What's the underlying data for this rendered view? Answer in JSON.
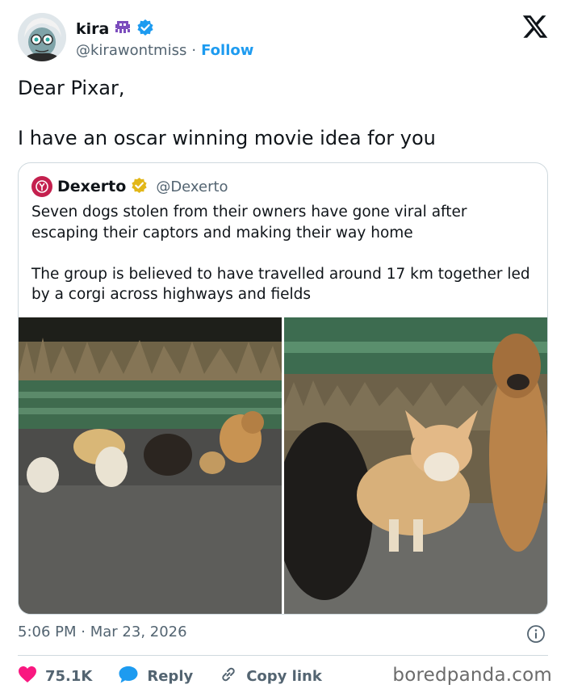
{
  "author": {
    "display_name": "kira",
    "handle": "@kirawontmiss",
    "separator": "·",
    "follow_label": "Follow"
  },
  "tweet": {
    "lines": [
      "Dear Pixar,",
      "I have an oscar winning movie idea for you"
    ]
  },
  "quoted": {
    "display_name": "Dexerto",
    "handle": "@Dexerto",
    "paragraphs": [
      "Seven dogs stolen from their owners have gone viral after escaping their captors and making their way home",
      "The group is believed to have travelled around 17 km together led by a corgi across highways and fields"
    ]
  },
  "meta": {
    "time": "5:06 PM",
    "separator": "·",
    "date": "Mar 23, 2026"
  },
  "actions": {
    "like_count": "75.1K",
    "reply_label": "Reply",
    "copy_label": "Copy link"
  },
  "watermark": "boredpanda.com",
  "colors": {
    "accent": "#1d9bf0",
    "like": "#f91880",
    "verified_gold": "#e2b719",
    "text_secondary": "#536471",
    "border": "#cfd9de"
  },
  "icons": [
    "x-logo-icon",
    "verified-badge-icon",
    "alien-emoji-icon",
    "gold-verified-badge-icon",
    "info-icon",
    "heart-icon",
    "reply-icon",
    "link-icon"
  ]
}
